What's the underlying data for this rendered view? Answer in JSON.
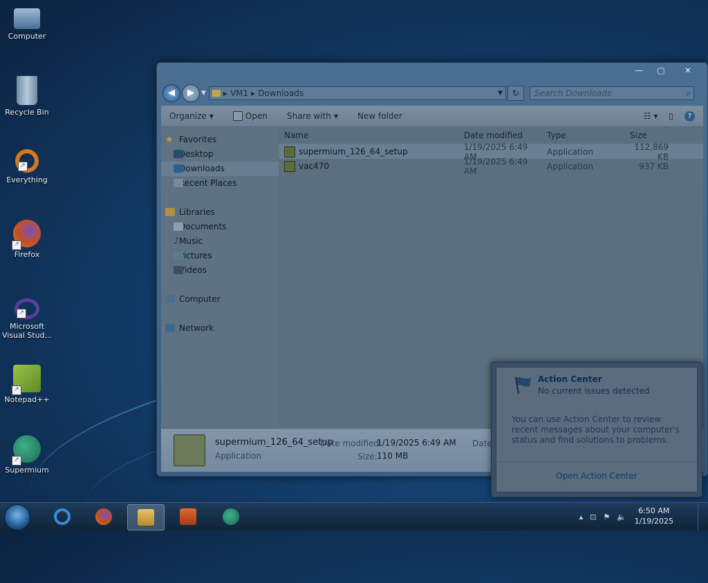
{
  "desktop": {
    "icons": [
      {
        "label": "Computer"
      },
      {
        "label": "Recycle Bin"
      },
      {
        "label": "Everything"
      },
      {
        "label": "Firefox"
      },
      {
        "label": "Microsoft Visual Stud..."
      },
      {
        "label": "Notepad++"
      },
      {
        "label": "Supermium"
      }
    ]
  },
  "window": {
    "controls": {
      "minimize": "—",
      "maximize": "▢",
      "close": "✕"
    },
    "address": {
      "crumbs": [
        "VM1",
        "Downloads"
      ]
    },
    "search": {
      "placeholder": "Search Downloads"
    },
    "toolbar": {
      "organize": "Organize",
      "open": "Open",
      "share_with": "Share with",
      "new_folder": "New folder"
    },
    "nav": {
      "favorites": "Favorites",
      "desktop": "Desktop",
      "downloads": "Downloads",
      "recent_places": "Recent Places",
      "libraries": "Libraries",
      "documents": "Documents",
      "music": "Music",
      "pictures": "Pictures",
      "videos": "Videos",
      "computer": "Computer",
      "network": "Network"
    },
    "columns": {
      "name": "Name",
      "date": "Date modified",
      "type": "Type",
      "size": "Size"
    },
    "files": [
      {
        "name": "supermium_126_64_setup",
        "date": "1/19/2025 6:49 AM",
        "type": "Application",
        "size": "112,869 KB"
      },
      {
        "name": "vac470",
        "date": "1/19/2025 6:49 AM",
        "type": "Application",
        "size": "937 KB"
      }
    ],
    "details": {
      "name": "supermium_126_64_setup",
      "type": "Application",
      "date_label": "Date modified:",
      "date_value": "1/19/2025 6:49 AM",
      "size_label": "Size:",
      "size_value": "110 MB",
      "date_created_label": "Date"
    }
  },
  "action_center": {
    "title": "Action Center",
    "subtitle": "No current issues detected",
    "body": "You can use Action Center to review recent messages about your computer's status and find solutions to problems.",
    "link": "Open Action Center"
  },
  "taskbar": {
    "clock_time": "6:50 AM",
    "clock_date": "1/19/2025",
    "tray_expand": "▴"
  }
}
